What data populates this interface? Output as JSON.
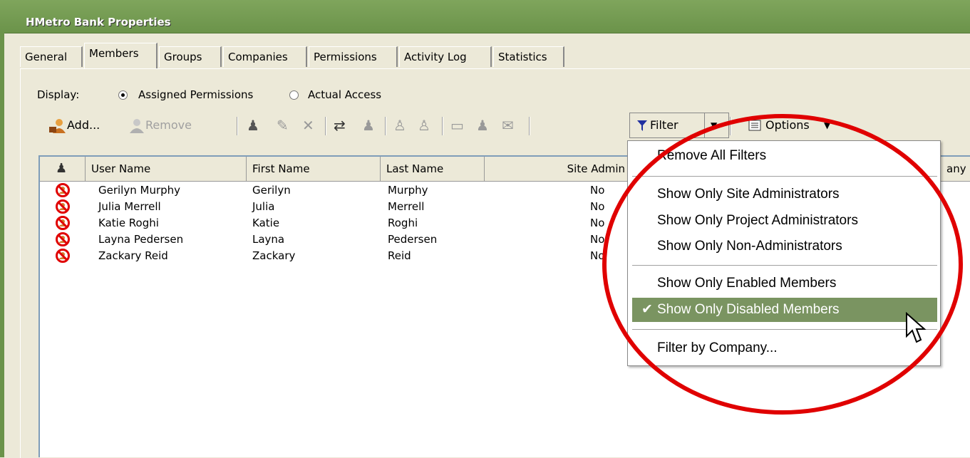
{
  "window": {
    "title": "HMetro Bank Properties"
  },
  "tabs": [
    "General",
    "Members",
    "Groups",
    "Companies",
    "Permissions",
    "Activity Log",
    "Statistics"
  ],
  "display": {
    "label": "Display:",
    "option1": "Assigned Permissions",
    "option2": "Actual Access"
  },
  "toolbar": {
    "add_label": "Add...",
    "remove_label": "Remove",
    "filter_label": "Filter",
    "options_label": "Options"
  },
  "columns": {
    "user": "User Name",
    "first": "First Name",
    "last": "Last Name",
    "site_admin": "Site Admin",
    "company_partial": "any"
  },
  "rows": [
    {
      "user": "Gerilyn Murphy",
      "first": "Gerilyn",
      "last": "Murphy",
      "site_admin": "No"
    },
    {
      "user": "Julia Merrell",
      "first": "Julia",
      "last": "Merrell",
      "site_admin": "No"
    },
    {
      "user": "Katie Roghi",
      "first": "Katie",
      "last": "Roghi",
      "site_admin": "No"
    },
    {
      "user": "Layna Pedersen",
      "first": "Layna",
      "last": "Pedersen",
      "site_admin": "No"
    },
    {
      "user": "Zackary Reid",
      "first": "Zackary",
      "last": "Reid",
      "site_admin": "No"
    }
  ],
  "filter_menu": {
    "remove_all": "Remove All Filters",
    "site_admins": "Show Only Site Administrators",
    "project_admins": "Show Only Project Administrators",
    "non_admins": "Show Only Non-Administrators",
    "enabled": "Show Only Enabled Members",
    "disabled": "Show Only Disabled Members",
    "by_company": "Filter by Company..."
  },
  "colors": {
    "title_bar": "#6B934A",
    "menu_highlight": "#7A9461",
    "annotation_circle": "#E00000"
  }
}
